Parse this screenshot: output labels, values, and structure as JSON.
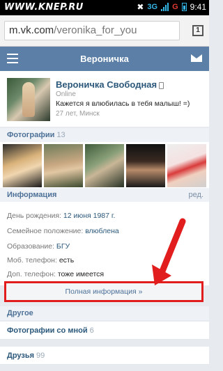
{
  "statusbar": {
    "watermark": "WWW.KNEP.RU",
    "network": "3G",
    "carrier_badge": "G",
    "time": "9:41"
  },
  "browser": {
    "url_host": "m.vk.com",
    "url_path": "/veronika_for_you",
    "tabs_count": "1"
  },
  "header": {
    "title": "Вероничка"
  },
  "profile": {
    "name": "Вероничка Свободная",
    "online": "Online",
    "status": "Кажется я влюбилась в тебя малыш! =)",
    "meta": "27 лет, Минск"
  },
  "photos": {
    "label": "Фотографии",
    "count": "13"
  },
  "info": {
    "label": "Информация",
    "edit": "ред.",
    "rows": [
      {
        "label": "День рождения:",
        "value": "12 июня 1987 г."
      },
      {
        "label": "Семейное положение:",
        "value": "влюблена"
      },
      {
        "label": "Образование:",
        "value": "БГУ"
      },
      {
        "label": "Моб. телефон:",
        "value": "есть"
      },
      {
        "label": "Доп. телефон:",
        "value": "тоже имеется"
      }
    ],
    "full_info": "Полная информация »"
  },
  "other": {
    "label": "Другое",
    "items": [
      {
        "label": "Фотографии со мной",
        "count": "6"
      },
      {
        "label": "Друзья",
        "count": "99"
      }
    ]
  },
  "colors": {
    "vk_blue": "#5b7fa6",
    "link": "#2b587a",
    "highlight": "#e11d1d"
  }
}
